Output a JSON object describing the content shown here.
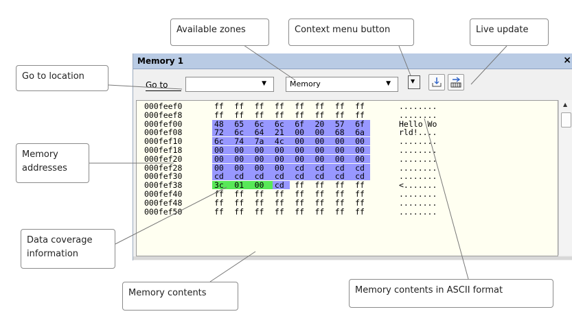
{
  "window": {
    "title": "Memory 1",
    "close_glyph": "×",
    "toolbar": {
      "goto_label": "Go to",
      "goto_value": "",
      "zone_value": "Memory",
      "context_menu_icon": "dropdown-box-icon",
      "toolbar_icon_1": "step-marker-icon",
      "toolbar_icon_2": "live-update-icon"
    }
  },
  "colors": {
    "highlight_blue": "#9898ff",
    "highlight_green": "#58e858",
    "titlebar": "#b9cbe4",
    "memory_bg": "#fffff1"
  },
  "memory": {
    "rows": [
      {
        "addr": "000feef0",
        "bytes": [
          "ff",
          "ff",
          "ff",
          "ff",
          "ff",
          "ff",
          "ff",
          "ff"
        ],
        "ascii": "........",
        "hl": [
          "",
          "",
          "",
          "",
          "",
          "",
          "",
          ""
        ]
      },
      {
        "addr": "000feef8",
        "bytes": [
          "ff",
          "ff",
          "ff",
          "ff",
          "ff",
          "ff",
          "ff",
          "ff"
        ],
        "ascii": "........",
        "hl": [
          "",
          "",
          "",
          "",
          "",
          "",
          "",
          ""
        ]
      },
      {
        "addr": "000fef00",
        "bytes": [
          "48",
          "65",
          "6c",
          "6c",
          "6f",
          "20",
          "57",
          "6f"
        ],
        "ascii": "Hello Wo",
        "hl": [
          "b",
          "b",
          "b",
          "b",
          "b",
          "b",
          "b",
          "b"
        ]
      },
      {
        "addr": "000fef08",
        "bytes": [
          "72",
          "6c",
          "64",
          "21",
          "00",
          "00",
          "68",
          "6a"
        ],
        "ascii": "rld!....",
        "hl": [
          "b",
          "b",
          "b",
          "b",
          "b",
          "b",
          "b",
          "b"
        ]
      },
      {
        "addr": "000fef10",
        "bytes": [
          "6c",
          "74",
          "7a",
          "4c",
          "00",
          "00",
          "00",
          "00"
        ],
        "ascii": "........",
        "hl": [
          "b",
          "b",
          "b",
          "b",
          "b",
          "b",
          "b",
          "b"
        ]
      },
      {
        "addr": "000fef18",
        "bytes": [
          "00",
          "00",
          "00",
          "00",
          "00",
          "00",
          "00",
          "00"
        ],
        "ascii": "........",
        "hl": [
          "b",
          "b",
          "b",
          "b",
          "b",
          "b",
          "b",
          "b"
        ]
      },
      {
        "addr": "000fef20",
        "bytes": [
          "00",
          "00",
          "00",
          "00",
          "00",
          "00",
          "00",
          "00"
        ],
        "ascii": "........",
        "hl": [
          "b",
          "b",
          "b",
          "b",
          "b",
          "b",
          "b",
          "b"
        ]
      },
      {
        "addr": "000fef28",
        "bytes": [
          "00",
          "00",
          "00",
          "00",
          "cd",
          "cd",
          "cd",
          "cd"
        ],
        "ascii": "........",
        "hl": [
          "b",
          "b",
          "b",
          "b",
          "b",
          "b",
          "b",
          "b"
        ]
      },
      {
        "addr": "000fef30",
        "bytes": [
          "cd",
          "cd",
          "cd",
          "cd",
          "cd",
          "cd",
          "cd",
          "cd"
        ],
        "ascii": "........",
        "hl": [
          "b",
          "b",
          "b",
          "b",
          "b",
          "b",
          "b",
          "b"
        ]
      },
      {
        "addr": "000fef38",
        "bytes": [
          "3c",
          "01",
          "00",
          "cd",
          "ff",
          "ff",
          "ff",
          "ff"
        ],
        "ascii": "<.......",
        "hl": [
          "g",
          "g",
          "g",
          "b",
          "",
          "",
          "",
          ""
        ]
      },
      {
        "addr": "000fef40",
        "bytes": [
          "ff",
          "ff",
          "ff",
          "ff",
          "ff",
          "ff",
          "ff",
          "ff"
        ],
        "ascii": "........",
        "hl": [
          "",
          "",
          "",
          "",
          "",
          "",
          "",
          ""
        ]
      },
      {
        "addr": "000fef48",
        "bytes": [
          "ff",
          "ff",
          "ff",
          "ff",
          "ff",
          "ff",
          "ff",
          "ff"
        ],
        "ascii": "........",
        "hl": [
          "",
          "",
          "",
          "",
          "",
          "",
          "",
          ""
        ]
      },
      {
        "addr": "000fef50",
        "bytes": [
          "ff",
          "ff",
          "ff",
          "ff",
          "ff",
          "ff",
          "ff",
          "ff"
        ],
        "ascii": "........",
        "hl": [
          "",
          "",
          "",
          "",
          "",
          "",
          "",
          ""
        ]
      }
    ]
  },
  "callouts": {
    "available_zones": "Available zones",
    "context_menu_button": "Context menu button",
    "live_update": "Live update",
    "go_to_location": "Go to location",
    "memory_addresses": "Memory addresses",
    "data_coverage": "Data coverage information",
    "memory_contents": "Memory contents",
    "memory_ascii": "Memory contents in ASCII format"
  }
}
